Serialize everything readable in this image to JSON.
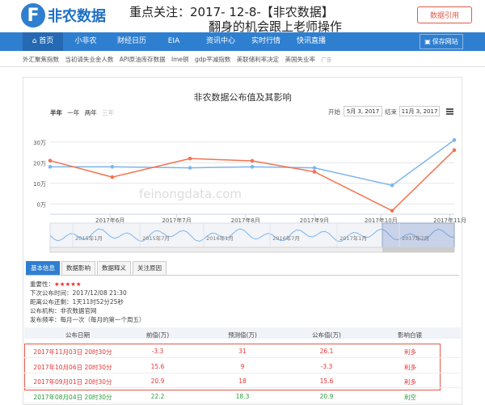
{
  "header": {
    "logo_glyph": "F",
    "logo_text": "非农数据",
    "headline_line1": "重点关注：2017- 12-8-【非农数据】",
    "headline_line2": "翻身的机会跟上老师操作",
    "cite_button": "数据引用"
  },
  "nav": {
    "items": [
      "首页",
      "小非农",
      "财经日历",
      "EIA",
      "资讯中心",
      "实时行情",
      "快讯直播"
    ],
    "save_label": "保存网站"
  },
  "subnav": {
    "items": [
      "外汇聚焦指数",
      "当初请失业金人数",
      "API原油库存数据",
      "lme铜",
      "gdp平减指数",
      "美联储利率决定",
      "美国失业率"
    ],
    "ad_tag": "广告"
  },
  "chart_controls": {
    "range_buttons": [
      "半年",
      "一年",
      "两年",
      "三年"
    ],
    "start_label": "开始",
    "start_date": "5月 3, 2017",
    "end_label": "结束",
    "end_date": "11月 3, 2017"
  },
  "chart_data": {
    "type": "line",
    "title": "非农数据公布值及其影响",
    "watermark": "feinongdata.com",
    "x": [
      "2017-05-05",
      "2017-06-02",
      "2017-07-07",
      "2017-08-04",
      "2017-09-01",
      "2017-10-06",
      "2017-11-03"
    ],
    "x_tick_labels": [
      "2017年6月",
      "2017年7月",
      "2017年8月",
      "2017年9月",
      "2017年10月",
      "2017年11月"
    ],
    "y_tick_labels": [
      "0万",
      "10万",
      "20万",
      "30万"
    ],
    "ylim": [
      -5,
      35
    ],
    "series": [
      {
        "color": "#7cb5ec",
        "values": [
          18,
          18,
          17.5,
          18,
          17.5,
          9,
          31
        ]
      },
      {
        "color": "#f4724f",
        "values": [
          21,
          13,
          22,
          20.9,
          15.6,
          -3.3,
          26.1
        ]
      }
    ],
    "navigator_labels": [
      "2015年1月",
      "2015年7月",
      "2016年1月",
      "2016年7月",
      "2017年1月",
      "2017年7月"
    ],
    "grid": true
  },
  "tabs": [
    "基本信息",
    "数据影响",
    "数据释义",
    "关注原因"
  ],
  "info": {
    "importance_label": "重要性：",
    "stars": "★★★★★",
    "next_release": "下次公布时间：2017/12/08 21:30",
    "countdown": "距离公布还剩：1天11时52分25秒",
    "agency": "公布机构：非农数据官网",
    "frequency": "发布频率：每月一次（每月的第一个周五）"
  },
  "table": {
    "headers": [
      "公布日期",
      "前值(万)",
      "预测值(万)",
      "公布值(万)",
      "影响白银"
    ],
    "rows": [
      {
        "date": "2017年11月03日 20时30分",
        "prev": "-3.3",
        "forecast": "31",
        "actual": "26.1",
        "impact": "利多",
        "color": "red"
      },
      {
        "date": "2017年10月06日 20时30分",
        "prev": "15.6",
        "forecast": "9",
        "actual": "-3.3",
        "impact": "利多",
        "color": "red"
      },
      {
        "date": "2017年09月01日 20时30分",
        "prev": "20.9",
        "forecast": "18",
        "actual": "15.6",
        "impact": "利多",
        "color": "red"
      },
      {
        "date": "2017年08月04日 20时30分",
        "prev": "22.2",
        "forecast": "18.3",
        "actual": "20.9",
        "impact": "利空",
        "color": "green"
      }
    ]
  }
}
